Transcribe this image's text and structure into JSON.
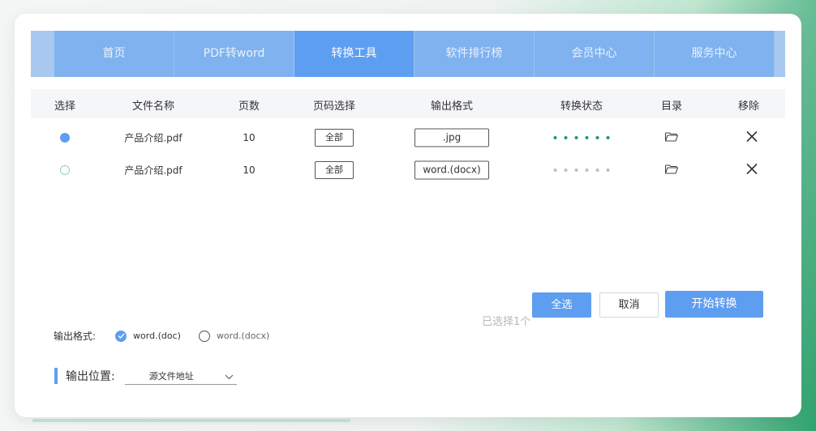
{
  "nav": {
    "tabs": [
      {
        "label": "首页"
      },
      {
        "label": "PDF转word"
      },
      {
        "label": "转换工具",
        "active": true
      },
      {
        "label": "软件排行榜"
      },
      {
        "label": "会员中心"
      },
      {
        "label": "服务中心"
      }
    ]
  },
  "table": {
    "headers": {
      "select": "选择",
      "filename": "文件名称",
      "pages": "页数",
      "page_range": "页码选择",
      "output_format": "输出格式",
      "status": "转换状态",
      "directory": "目录",
      "remove": "移除"
    },
    "rows": [
      {
        "selected": true,
        "filename": "产品介绍.pdf",
        "pages": "10",
        "page_range": "全部",
        "format": ".jpg",
        "status": "done"
      },
      {
        "selected": false,
        "filename": "产品介绍.pdf",
        "pages": "10",
        "page_range": "全部",
        "format": "word.(docx)",
        "status": "pending"
      }
    ]
  },
  "actions": {
    "selected_count": "已选择1个",
    "select_all": "全选",
    "cancel": "取消",
    "start": "开始转换"
  },
  "output_format": {
    "label": "输出格式:",
    "options": [
      {
        "label": "word.(doc)",
        "checked": true
      },
      {
        "label": "word.(docx)",
        "checked": false
      }
    ]
  },
  "output_location": {
    "label": "输出位置:",
    "value": "源文件地址"
  },
  "colors": {
    "accent": "#5e9ef0",
    "nav_bg": "#7fb2ef",
    "status_done": "#1f9a62"
  }
}
